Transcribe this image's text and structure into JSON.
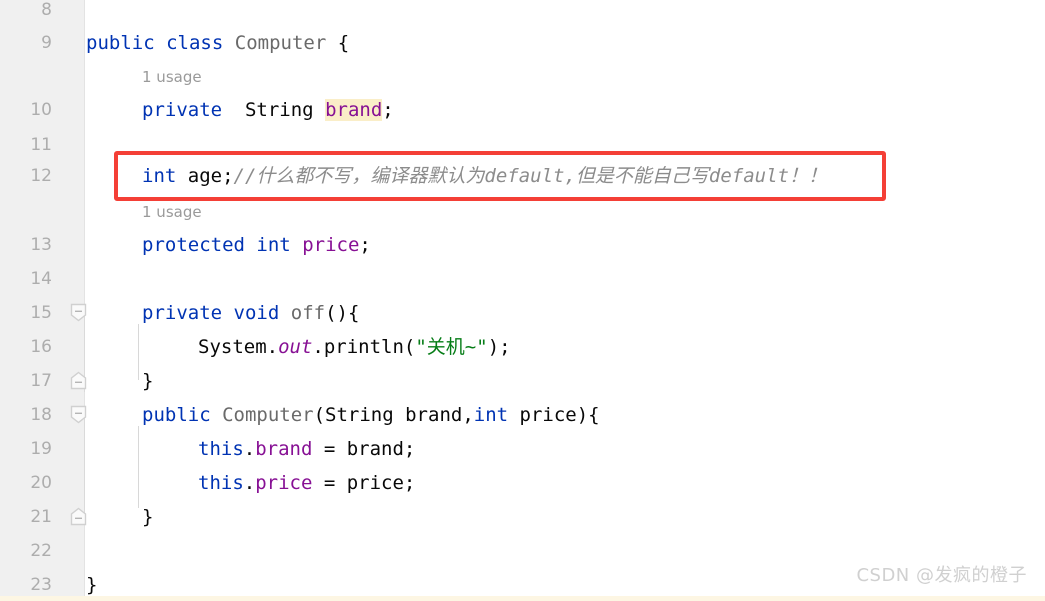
{
  "editor": {
    "language": "java",
    "theme": "IntelliJ Light",
    "colors": {
      "background": "#ffffff",
      "gutter_background": "#f0f0f0",
      "line_number": "#adadad",
      "keyword": "#0033b3",
      "class_name": "#6a6a6a",
      "field": "#871094",
      "string": "#067d17",
      "comment": "#8c8c8c",
      "identifier_highlight": "#faeec8",
      "annotation_box": "#f43f36",
      "watermark": "#d0d0d0"
    }
  },
  "gutter": {
    "line_numbers": [
      "8",
      "9",
      "10",
      "11",
      "12",
      "13",
      "14",
      "15",
      "16",
      "17",
      "18",
      "19",
      "20",
      "21",
      "22",
      "23"
    ],
    "fold_markers": [
      {
        "line": "15",
        "state": "expanded-start"
      },
      {
        "line": "17",
        "state": "expanded-end"
      },
      {
        "line": "18",
        "state": "expanded-start"
      },
      {
        "line": "21",
        "state": "expanded-end"
      }
    ]
  },
  "code": {
    "inlay_hints": [
      {
        "text": "1 usage",
        "after_line": "9"
      },
      {
        "text": "1 usage",
        "after_line": "12"
      }
    ],
    "lines": [
      {
        "number": "8",
        "indent": 0,
        "tokens": []
      },
      {
        "number": "9",
        "indent": 0,
        "tokens": [
          {
            "t": "public",
            "c": "kw"
          },
          {
            "t": " ",
            "c": "plain"
          },
          {
            "t": "class",
            "c": "kw"
          },
          {
            "t": " ",
            "c": "plain"
          },
          {
            "t": "Computer",
            "c": "type"
          },
          {
            "t": " {",
            "c": "plain"
          }
        ]
      },
      {
        "number": "10",
        "indent": 1,
        "tokens": [
          {
            "t": "private",
            "c": "kw"
          },
          {
            "t": "  ",
            "c": "plain"
          },
          {
            "t": "String",
            "c": "plain"
          },
          {
            "t": " ",
            "c": "plain"
          },
          {
            "t": "brand",
            "c": "fld hl"
          },
          {
            "t": ";",
            "c": "plain"
          }
        ]
      },
      {
        "number": "11",
        "indent": 0,
        "tokens": []
      },
      {
        "number": "12",
        "indent": 1,
        "tokens": [
          {
            "t": "int",
            "c": "kw"
          },
          {
            "t": " age;",
            "c": "plain"
          },
          {
            "t": "//什么都不写，编译器默认为default,但是不能自己写default！！",
            "c": "cmt"
          }
        ]
      },
      {
        "number": "13",
        "indent": 1,
        "tokens": [
          {
            "t": "protected",
            "c": "kw"
          },
          {
            "t": " ",
            "c": "plain"
          },
          {
            "t": "int",
            "c": "kw"
          },
          {
            "t": " ",
            "c": "plain"
          },
          {
            "t": "price",
            "c": "fld"
          },
          {
            "t": ";",
            "c": "plain"
          }
        ]
      },
      {
        "number": "14",
        "indent": 0,
        "tokens": []
      },
      {
        "number": "15",
        "indent": 1,
        "tokens": [
          {
            "t": "private",
            "c": "kw"
          },
          {
            "t": " ",
            "c": "plain"
          },
          {
            "t": "void",
            "c": "kw"
          },
          {
            "t": " ",
            "c": "plain"
          },
          {
            "t": "off",
            "c": "type"
          },
          {
            "t": "(){",
            "c": "plain"
          }
        ]
      },
      {
        "number": "16",
        "indent": 2,
        "tokens": [
          {
            "t": "System.",
            "c": "plain"
          },
          {
            "t": "out",
            "c": "fldi"
          },
          {
            "t": ".println(",
            "c": "plain"
          },
          {
            "t": "\"关机~\"",
            "c": "str"
          },
          {
            "t": ");",
            "c": "plain"
          }
        ]
      },
      {
        "number": "17",
        "indent": 1,
        "tokens": [
          {
            "t": "}",
            "c": "plain"
          }
        ]
      },
      {
        "number": "18",
        "indent": 1,
        "tokens": [
          {
            "t": "public",
            "c": "kw"
          },
          {
            "t": " ",
            "c": "plain"
          },
          {
            "t": "Computer",
            "c": "type"
          },
          {
            "t": "(String brand,",
            "c": "plain"
          },
          {
            "t": "int",
            "c": "kw"
          },
          {
            "t": " price){",
            "c": "plain"
          }
        ]
      },
      {
        "number": "19",
        "indent": 2,
        "tokens": [
          {
            "t": "this",
            "c": "kw"
          },
          {
            "t": ".",
            "c": "plain"
          },
          {
            "t": "brand",
            "c": "fld"
          },
          {
            "t": " = brand;",
            "c": "plain"
          }
        ]
      },
      {
        "number": "20",
        "indent": 2,
        "tokens": [
          {
            "t": "this",
            "c": "kw"
          },
          {
            "t": ".",
            "c": "plain"
          },
          {
            "t": "price",
            "c": "fld"
          },
          {
            "t": " = price;",
            "c": "plain"
          }
        ]
      },
      {
        "number": "21",
        "indent": 1,
        "tokens": [
          {
            "t": "}",
            "c": "plain"
          }
        ]
      },
      {
        "number": "22",
        "indent": 0,
        "tokens": []
      },
      {
        "number": "23",
        "indent": 0,
        "tokens": [
          {
            "t": "}",
            "c": "plain"
          }
        ]
      }
    ]
  },
  "annotation": {
    "type": "red-rectangle",
    "targets_line": "12",
    "label": "int age;//什么都不写，编译器默认为default,但是不能自己写default！！"
  },
  "watermark": {
    "text": "CSDN @发疯的橙子"
  }
}
